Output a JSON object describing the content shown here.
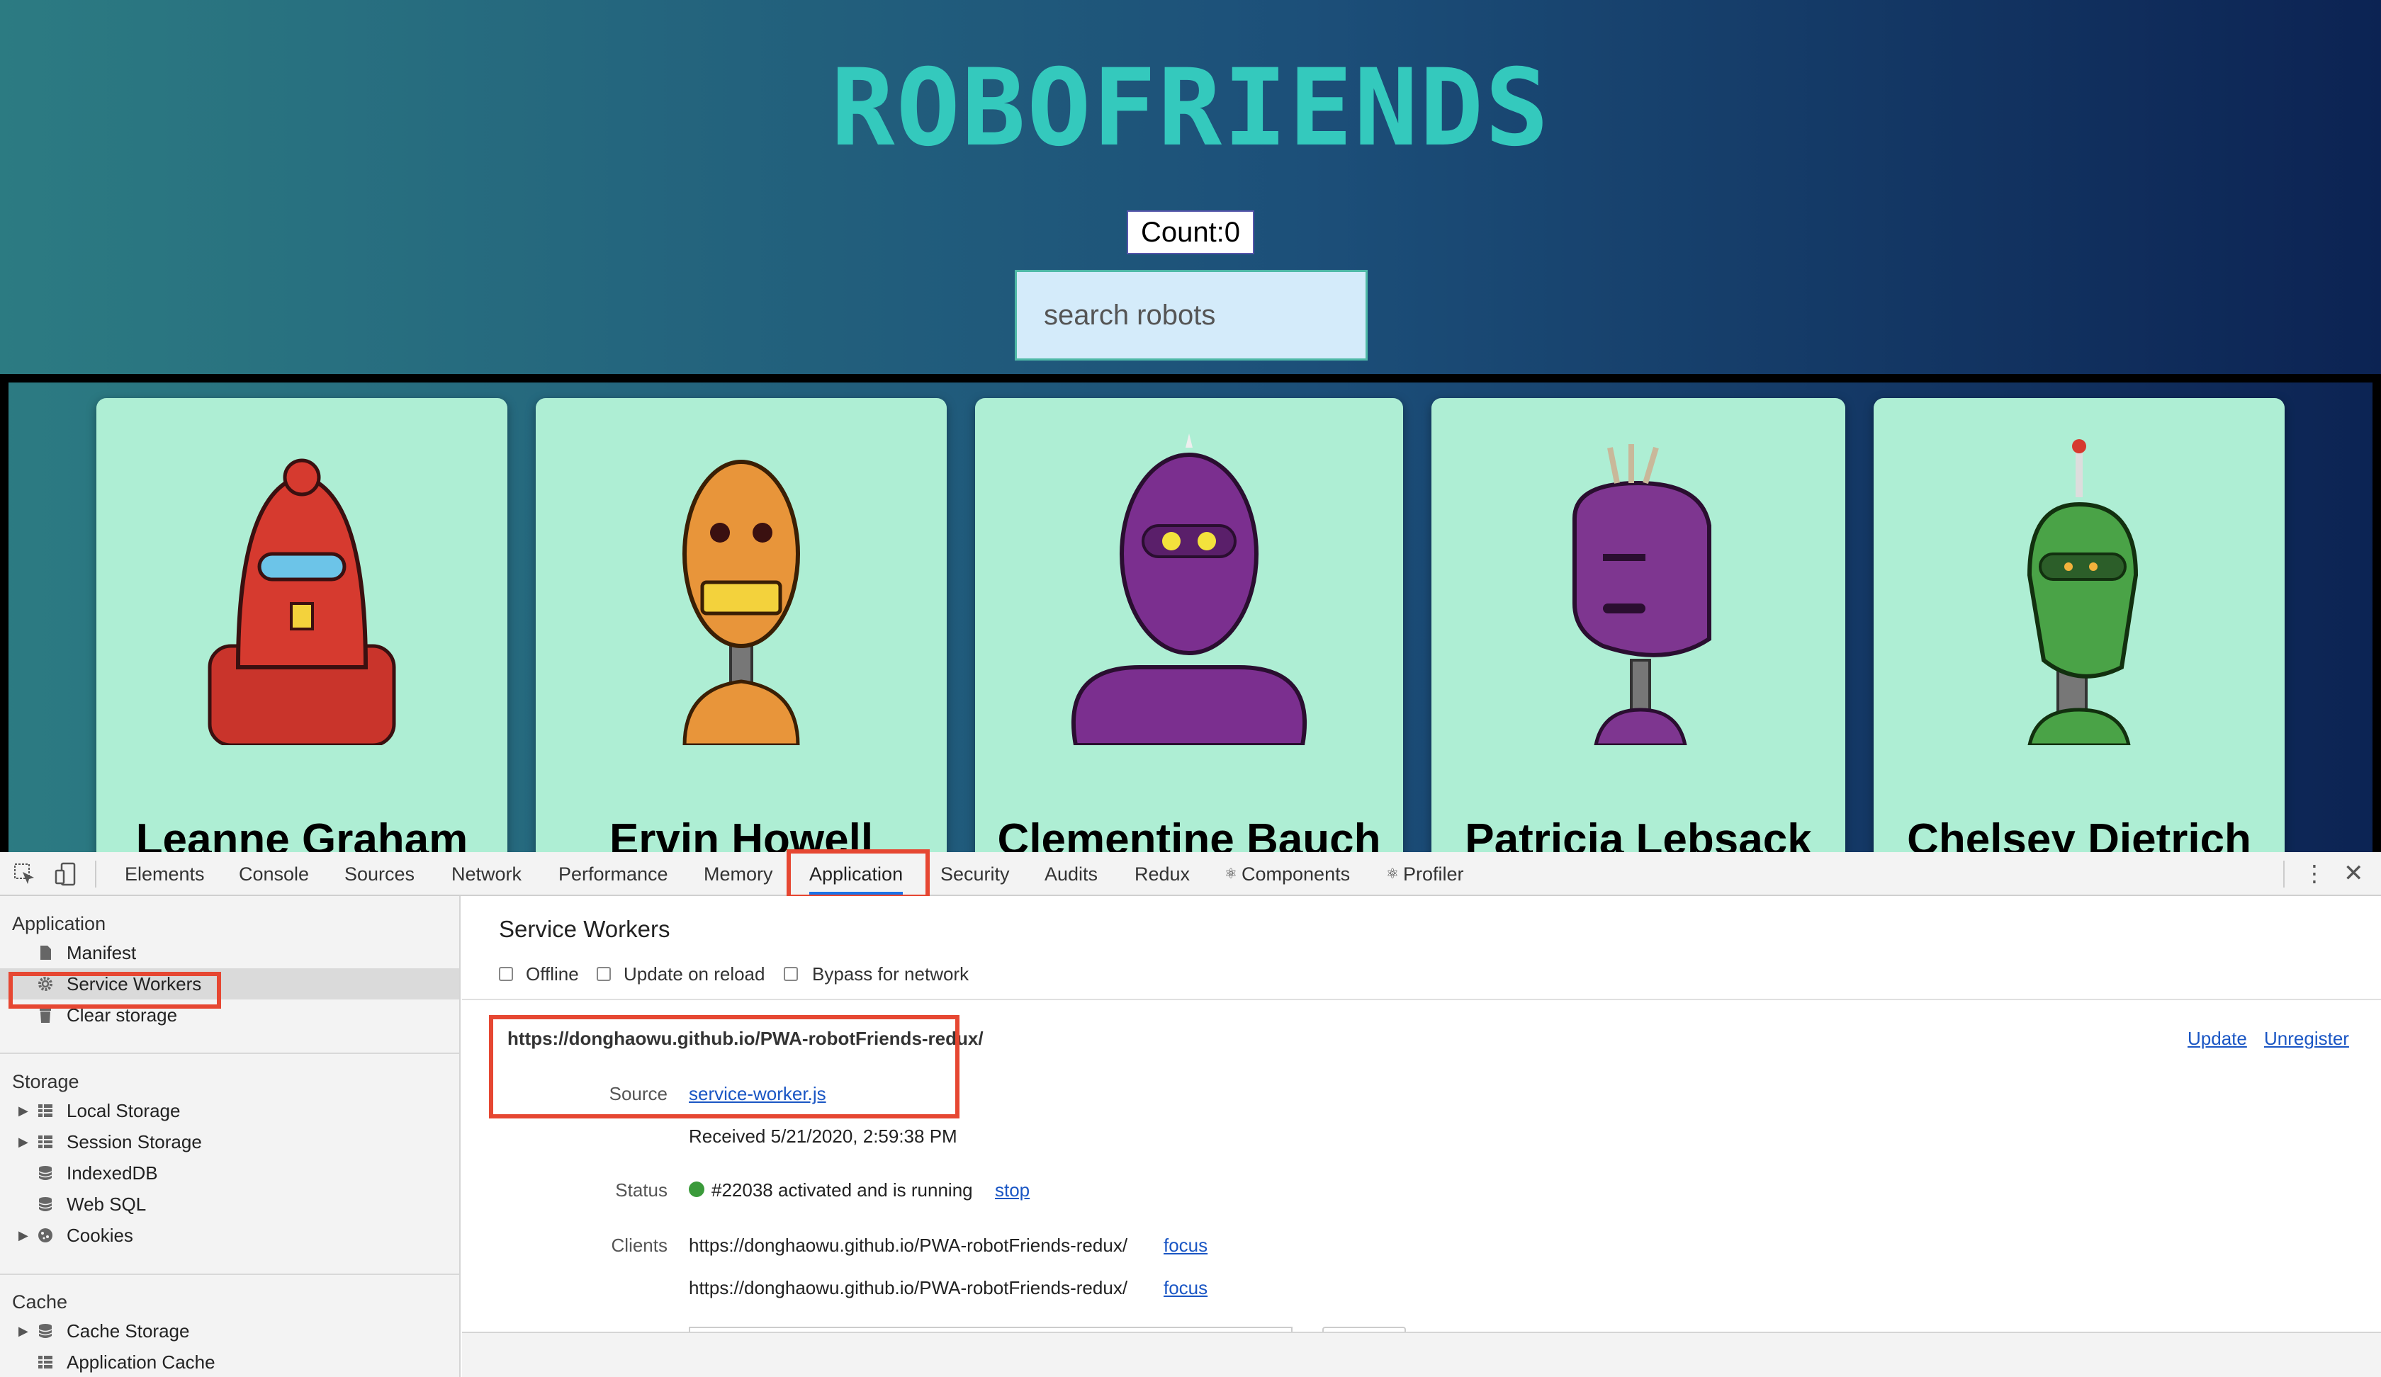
{
  "app": {
    "title": "ROBOFRIENDS",
    "count_label": "Count:0",
    "search_placeholder": "search robots",
    "robots": [
      {
        "name": "Leanne Graham",
        "color": "#d63a2f"
      },
      {
        "name": "Ervin Howell",
        "color": "#e8953a"
      },
      {
        "name": "Clementine Bauch",
        "color": "#7b2f8f"
      },
      {
        "name": "Patricia Lebsack",
        "color": "#7e3690"
      },
      {
        "name": "Chelsey Dietrich",
        "color": "#4aa347"
      }
    ]
  },
  "devtools": {
    "tabs": [
      "Elements",
      "Console",
      "Sources",
      "Network",
      "Performance",
      "Memory",
      "Application",
      "Security",
      "Audits",
      "Redux",
      "Components",
      "Profiler"
    ],
    "active_tab": "Application",
    "sidebar": {
      "application_header": "Application",
      "application_items": [
        "Manifest",
        "Service Workers",
        "Clear storage"
      ],
      "selected_item": "Service Workers",
      "storage_header": "Storage",
      "storage_items": [
        "Local Storage",
        "Session Storage",
        "IndexedDB",
        "Web SQL",
        "Cookies"
      ],
      "cache_header": "Cache",
      "cache_items": [
        "Cache Storage",
        "Application Cache"
      ]
    },
    "service_workers": {
      "title": "Service Workers",
      "checkboxes": [
        "Offline",
        "Update on reload",
        "Bypass for network"
      ],
      "scope_url": "https://donghaowu.github.io/PWA-robotFriends-redux/",
      "update_link": "Update",
      "unregister_link": "Unregister",
      "source_label": "Source",
      "source_file": "service-worker.js",
      "received": "Received 5/21/2020, 2:59:38 PM",
      "status_label": "Status",
      "status_text": "#22038 activated and is running",
      "status_color": "#3a9a3a",
      "stop_link": "stop",
      "clients_label": "Clients",
      "clients": [
        {
          "url": "https://donghaowu.github.io/PWA-robotFriends-redux/",
          "action": "focus"
        },
        {
          "url": "https://donghaowu.github.io/PWA-robotFriends-redux/",
          "action": "focus"
        }
      ]
    }
  }
}
